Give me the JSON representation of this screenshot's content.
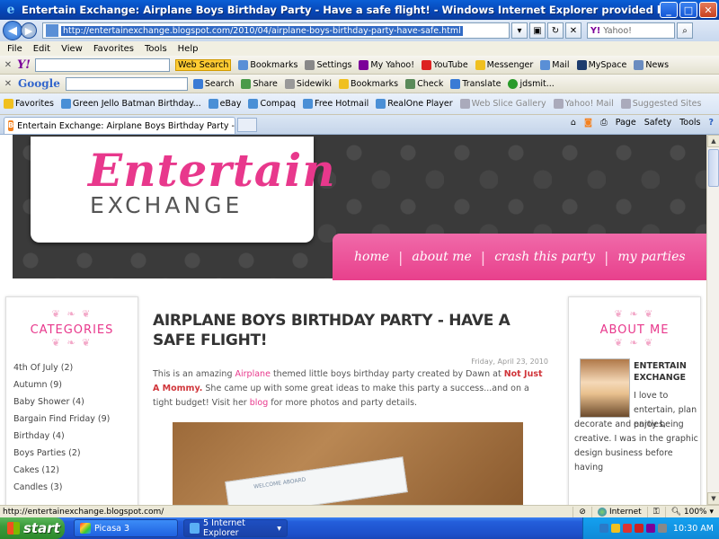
{
  "window": {
    "title": "Entertain Exchange: Airplane Boys Birthday Party - Have a safe flight! - Windows Internet Explorer provided by Yahoo!",
    "minimize": "_",
    "maximize": "□",
    "close": "✕"
  },
  "address": {
    "url": "http://entertainexchange.blogspot.com/2010/04/airplane-boys-birthday-party-have-safe.html",
    "search_placeholder": "Yahoo!"
  },
  "menu": [
    "File",
    "Edit",
    "View",
    "Favorites",
    "Tools",
    "Help"
  ],
  "yahoo_toolbar": {
    "logo": "Y!",
    "search_button": "Web Search",
    "items": [
      "Bookmarks",
      "Settings",
      "My Yahoo!",
      "YouTube",
      "Messenger",
      "Mail",
      "MySpace",
      "News"
    ]
  },
  "google_toolbar": {
    "logo": "Google",
    "items": [
      "Search",
      "Share",
      "Sidewiki",
      "Bookmarks",
      "Check",
      "Translate",
      "jdsmit..."
    ]
  },
  "favorites_bar": {
    "label": "Favorites",
    "items": [
      "Green Jello Batman Birthday...",
      "eBay",
      "Compaq",
      "Free Hotmail",
      "RealOne Player",
      "Web Slice Gallery",
      "Yahoo! Mail",
      "Suggested Sites"
    ]
  },
  "tabs": {
    "active": "Entertain Exchange: Airplane Boys Birthday Party - H..."
  },
  "command_bar": [
    "Page",
    "Safety",
    "Tools"
  ],
  "blog": {
    "logo_top": "Entertain",
    "logo_bottom": "EXCHANGE",
    "nav": [
      "home",
      "about me",
      "crash this party",
      "my parties"
    ]
  },
  "categories": {
    "title": "CATEGORIES",
    "items": [
      "4th Of July (2)",
      "Autumn (9)",
      "Baby Shower (4)",
      "Bargain Find Friday (9)",
      "Birthday (4)",
      "Boys Parties (2)",
      "Cakes (12)",
      "Candles (3)"
    ]
  },
  "about": {
    "title": "ABOUT ME",
    "name_line1": "ENTERTAIN",
    "name_line2": "EXCHANGE",
    "text1": "I love to entertain, plan parties,",
    "text2": "decorate and enjoy being creative. I was in the graphic design business before having"
  },
  "post": {
    "title": "AIRPLANE BOYS BIRTHDAY PARTY - HAVE A SAFE FLIGHT!",
    "date": "Friday, April 23, 2010",
    "body_1": "This is an amazing",
    "link_airplane": "Airplane",
    "body_2": "themed little boys birthday party created by Dawn at",
    "link_mommy": "Not Just A Mommy.",
    "body_3": "She came up with some great ideas to make this party a success...and on a tight budget! Visit her",
    "link_blog": "blog",
    "body_4": "for more photos and party details.",
    "photo_text": "WELCOME ABOARD"
  },
  "status": {
    "url": "http://entertainexchange.blogspot.com/",
    "zone": "Internet",
    "zoom": "100%"
  },
  "taskbar": {
    "start": "start",
    "items": [
      "Picasa 3",
      "5 Internet Explorer"
    ],
    "clock": "10:30 AM"
  }
}
